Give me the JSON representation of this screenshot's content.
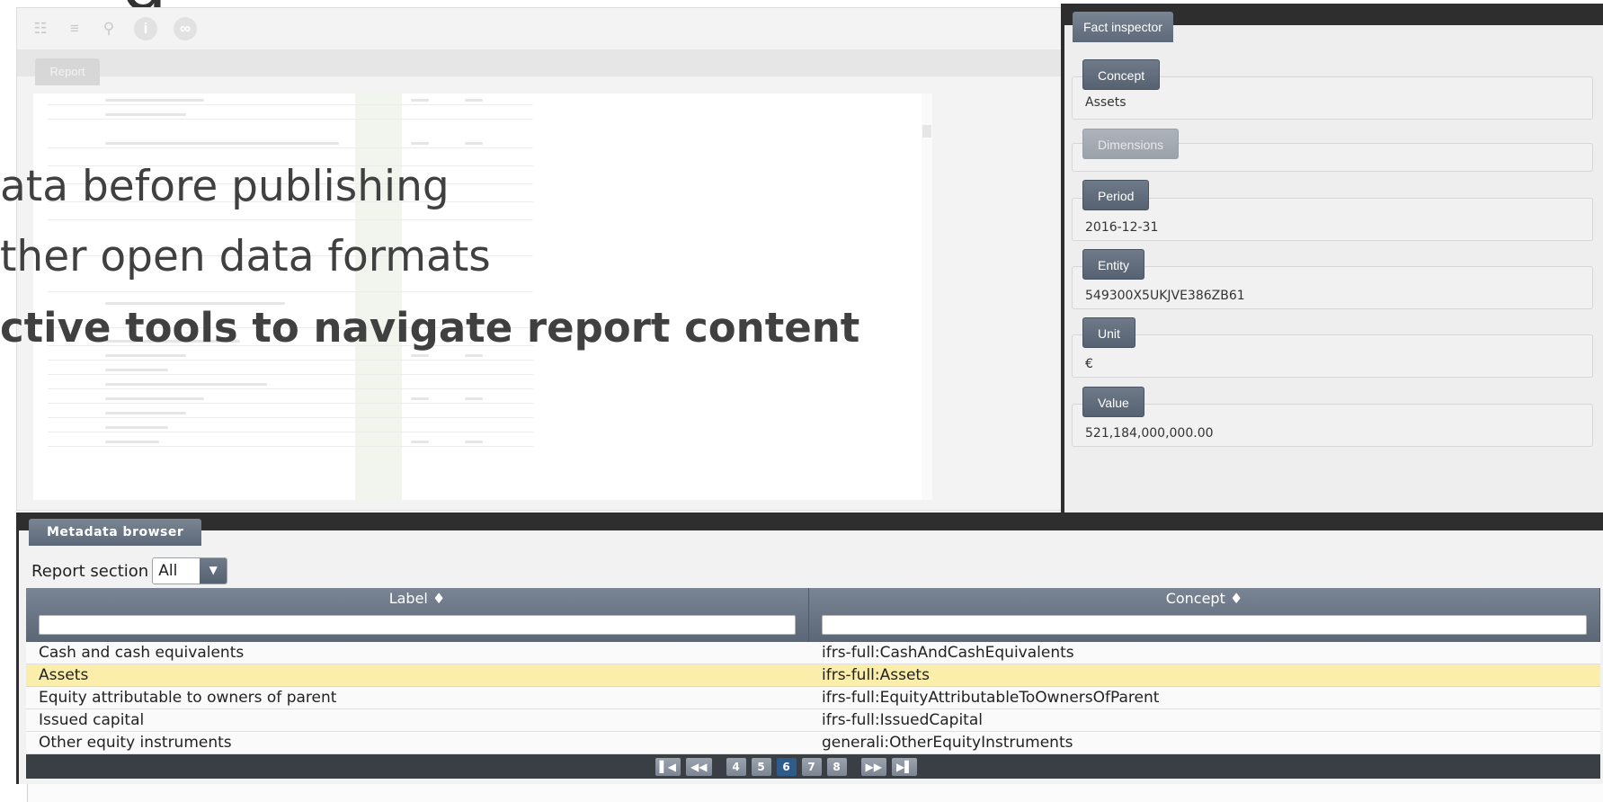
{
  "slide": {
    "heading_fragment": "g",
    "bullets": [
      "ata before publishing",
      "ther open data formats",
      "ctive tools to navigate report content"
    ]
  },
  "viewer": {
    "report_tab": "Report",
    "toolbar_icons": [
      "hierarchy-icon",
      "list-icon",
      "search-icon",
      "info-icon",
      "link-icon"
    ]
  },
  "fact_inspector": {
    "title": "Fact inspector",
    "fields": [
      {
        "label": "Concept",
        "value": "Assets"
      },
      {
        "label": "Dimensions",
        "value": ""
      },
      {
        "label": "Period",
        "value": "2016-12-31"
      },
      {
        "label": "Entity",
        "value": "549300X5UKJVE386ZB61"
      },
      {
        "label": "Unit",
        "value": "€"
      },
      {
        "label": "Value",
        "value": "521,184,000,000.00"
      }
    ]
  },
  "metadata_browser": {
    "title": "Metadata browser",
    "report_section_label": "Report section",
    "report_section_value": "All",
    "columns": [
      "Label ♦",
      "Concept ♦"
    ],
    "rows": [
      {
        "label": "Cash and cash equivalents",
        "concept": "ifrs-full:CashAndCashEquivalents"
      },
      {
        "label": "Assets",
        "concept": "ifrs-full:Assets"
      },
      {
        "label": "Equity attributable to owners of parent",
        "concept": "ifrs-full:EquityAttributableToOwnersOfParent"
      },
      {
        "label": "Issued capital",
        "concept": "ifrs-full:IssuedCapital"
      },
      {
        "label": "Other equity instruments",
        "concept": "generali:OtherEquityInstruments"
      }
    ],
    "selected_row": 1,
    "pager": {
      "first": "▌◀",
      "prev": "◀◀",
      "pages": [
        "4",
        "5",
        "6",
        "7",
        "8"
      ],
      "current": "6",
      "next": "▶▶",
      "last": "▶▌"
    }
  }
}
